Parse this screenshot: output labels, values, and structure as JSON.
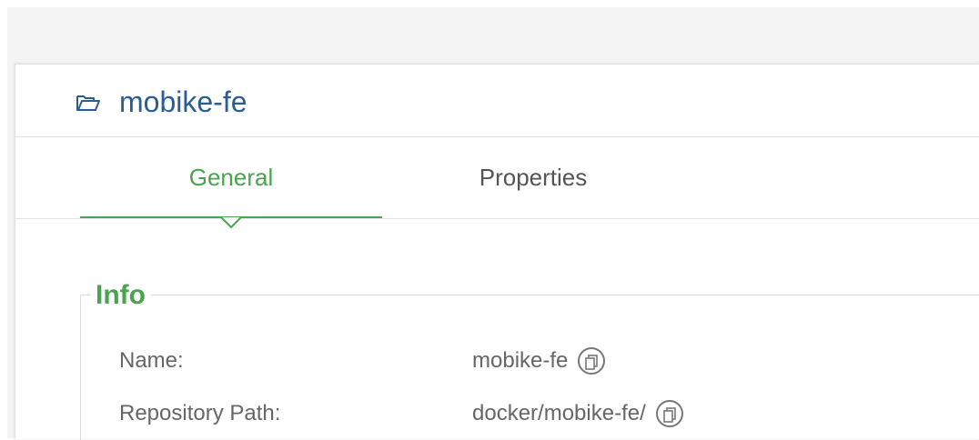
{
  "header": {
    "title": "mobike-fe",
    "icon": "folder-open-icon"
  },
  "tabs": [
    {
      "label": "General",
      "active": true
    },
    {
      "label": "Properties",
      "active": false
    }
  ],
  "info": {
    "legend": "Info",
    "fields": [
      {
        "label": "Name:",
        "value": "mobike-fe",
        "icon": "copy-icon"
      },
      {
        "label": "Repository Path:",
        "value": "docker/mobike-fe/",
        "icon": "copy-icon"
      }
    ]
  },
  "colors": {
    "title": "#2a5d94",
    "accent_green": "#4aa34e",
    "text_gray": "#666666",
    "border": "#e3e3e3"
  }
}
